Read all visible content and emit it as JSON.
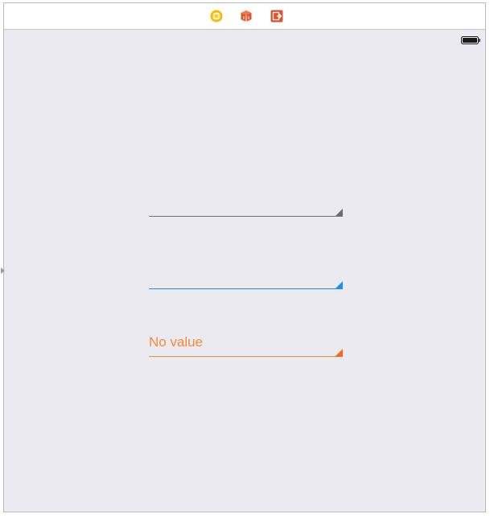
{
  "scene_dock": {
    "icons": [
      {
        "name": "view-controller-icon",
        "color": "#f5b800"
      },
      {
        "name": "first-responder-icon",
        "color": "#e0532b"
      },
      {
        "name": "exit-icon",
        "color": "#e0532b"
      }
    ]
  },
  "status_bar": {
    "battery_icon": "battery-icon"
  },
  "fields": [
    {
      "value": "",
      "underline_color": "#6d6d72"
    },
    {
      "value": "",
      "underline_color": "#1e8ef0"
    },
    {
      "value": "No value",
      "underline_color": "#f08a3c"
    }
  ]
}
